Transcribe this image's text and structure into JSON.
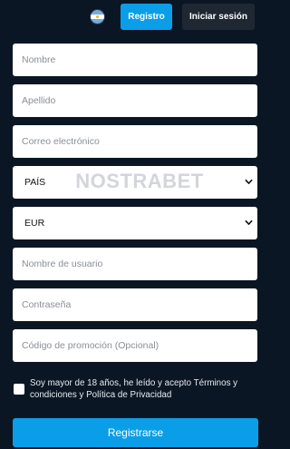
{
  "header": {
    "flag_icon": "argentina-flag-icon",
    "register_label": "Registro",
    "login_label": "Iniciar sesión"
  },
  "form": {
    "first_name_placeholder": "Nombre",
    "last_name_placeholder": "Apellido",
    "email_placeholder": "Correo electrónico",
    "country_value": "PAÍS",
    "currency_value": "EUR",
    "username_placeholder": "Nombre de usuario",
    "password_placeholder": "Contraseña",
    "promo_placeholder": "Código de promoción (Opcional)",
    "terms_label": "Soy mayor de 18 años, he leído y acepto Términos y condiciones y Política de Privacidad",
    "submit_label": "Registrarse"
  },
  "watermark": {
    "text": "NOSTRABET"
  },
  "colors": {
    "background": "#0b1624",
    "accent": "#0b9ee8",
    "secondary_button": "#1f2733"
  }
}
